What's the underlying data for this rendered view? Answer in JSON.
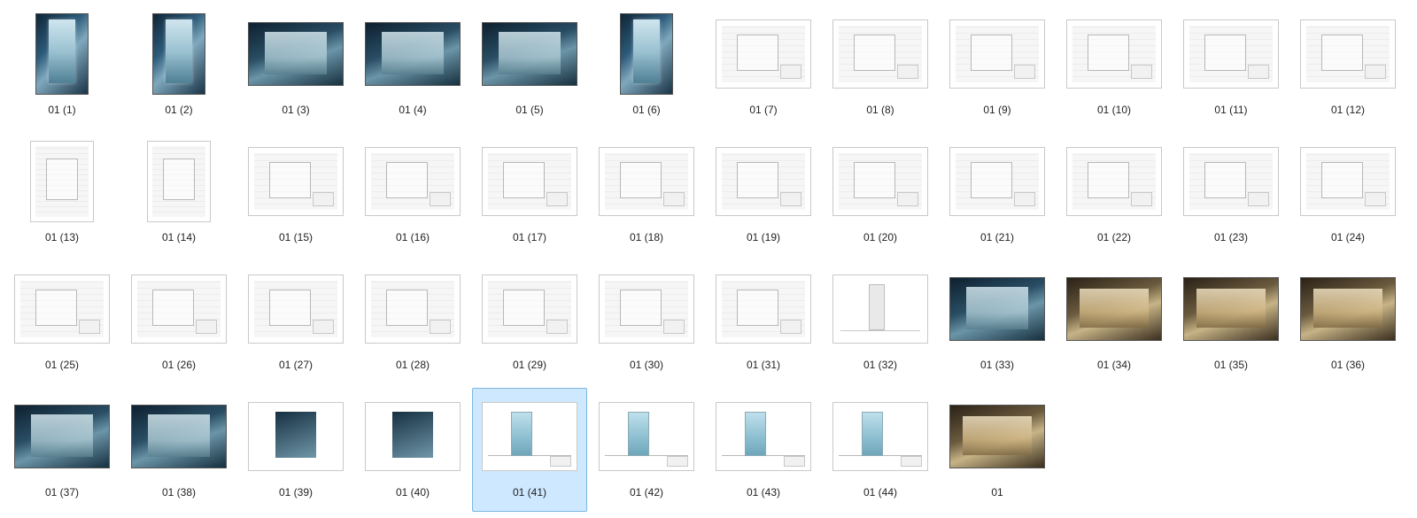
{
  "selected_index": 40,
  "items": [
    {
      "label": "01 (1)",
      "kind": "render-tall"
    },
    {
      "label": "01 (2)",
      "kind": "render-tall"
    },
    {
      "label": "01 (3)",
      "kind": "render-wide"
    },
    {
      "label": "01 (4)",
      "kind": "render-wide"
    },
    {
      "label": "01 (5)",
      "kind": "render-wide"
    },
    {
      "label": "01 (6)",
      "kind": "render-tall"
    },
    {
      "label": "01 (7)",
      "kind": "blueprint"
    },
    {
      "label": "01 (8)",
      "kind": "blueprint"
    },
    {
      "label": "01 (9)",
      "kind": "blueprint"
    },
    {
      "label": "01 (10)",
      "kind": "blueprint"
    },
    {
      "label": "01 (11)",
      "kind": "blueprint"
    },
    {
      "label": "01 (12)",
      "kind": "blueprint"
    },
    {
      "label": "01 (13)",
      "kind": "blueprint-tall"
    },
    {
      "label": "01 (14)",
      "kind": "blueprint-tall"
    },
    {
      "label": "01 (15)",
      "kind": "blueprint"
    },
    {
      "label": "01 (16)",
      "kind": "blueprint"
    },
    {
      "label": "01 (17)",
      "kind": "blueprint"
    },
    {
      "label": "01 (18)",
      "kind": "blueprint"
    },
    {
      "label": "01 (19)",
      "kind": "blueprint"
    },
    {
      "label": "01 (20)",
      "kind": "blueprint"
    },
    {
      "label": "01 (21)",
      "kind": "blueprint"
    },
    {
      "label": "01 (22)",
      "kind": "blueprint"
    },
    {
      "label": "01 (23)",
      "kind": "blueprint"
    },
    {
      "label": "01 (24)",
      "kind": "blueprint"
    },
    {
      "label": "01 (25)",
      "kind": "blueprint"
    },
    {
      "label": "01 (26)",
      "kind": "blueprint"
    },
    {
      "label": "01 (27)",
      "kind": "blueprint"
    },
    {
      "label": "01 (28)",
      "kind": "blueprint"
    },
    {
      "label": "01 (29)",
      "kind": "blueprint"
    },
    {
      "label": "01 (30)",
      "kind": "blueprint"
    },
    {
      "label": "01 (31)",
      "kind": "blueprint"
    },
    {
      "label": "01 (32)",
      "kind": "elev-sketch"
    },
    {
      "label": "01 (33)",
      "kind": "render-wide"
    },
    {
      "label": "01 (34)",
      "kind": "render-warm"
    },
    {
      "label": "01 (35)",
      "kind": "render-warm"
    },
    {
      "label": "01 (36)",
      "kind": "render-warm"
    },
    {
      "label": "01 (37)",
      "kind": "render-wide"
    },
    {
      "label": "01 (38)",
      "kind": "render-wide"
    },
    {
      "label": "01 (39)",
      "kind": "render-whitebg"
    },
    {
      "label": "01 (40)",
      "kind": "render-whitebg"
    },
    {
      "label": "01 (41)",
      "kind": "elevation"
    },
    {
      "label": "01 (42)",
      "kind": "elevation"
    },
    {
      "label": "01 (43)",
      "kind": "elevation"
    },
    {
      "label": "01 (44)",
      "kind": "elevation"
    },
    {
      "label": "01",
      "kind": "render-warm"
    }
  ]
}
